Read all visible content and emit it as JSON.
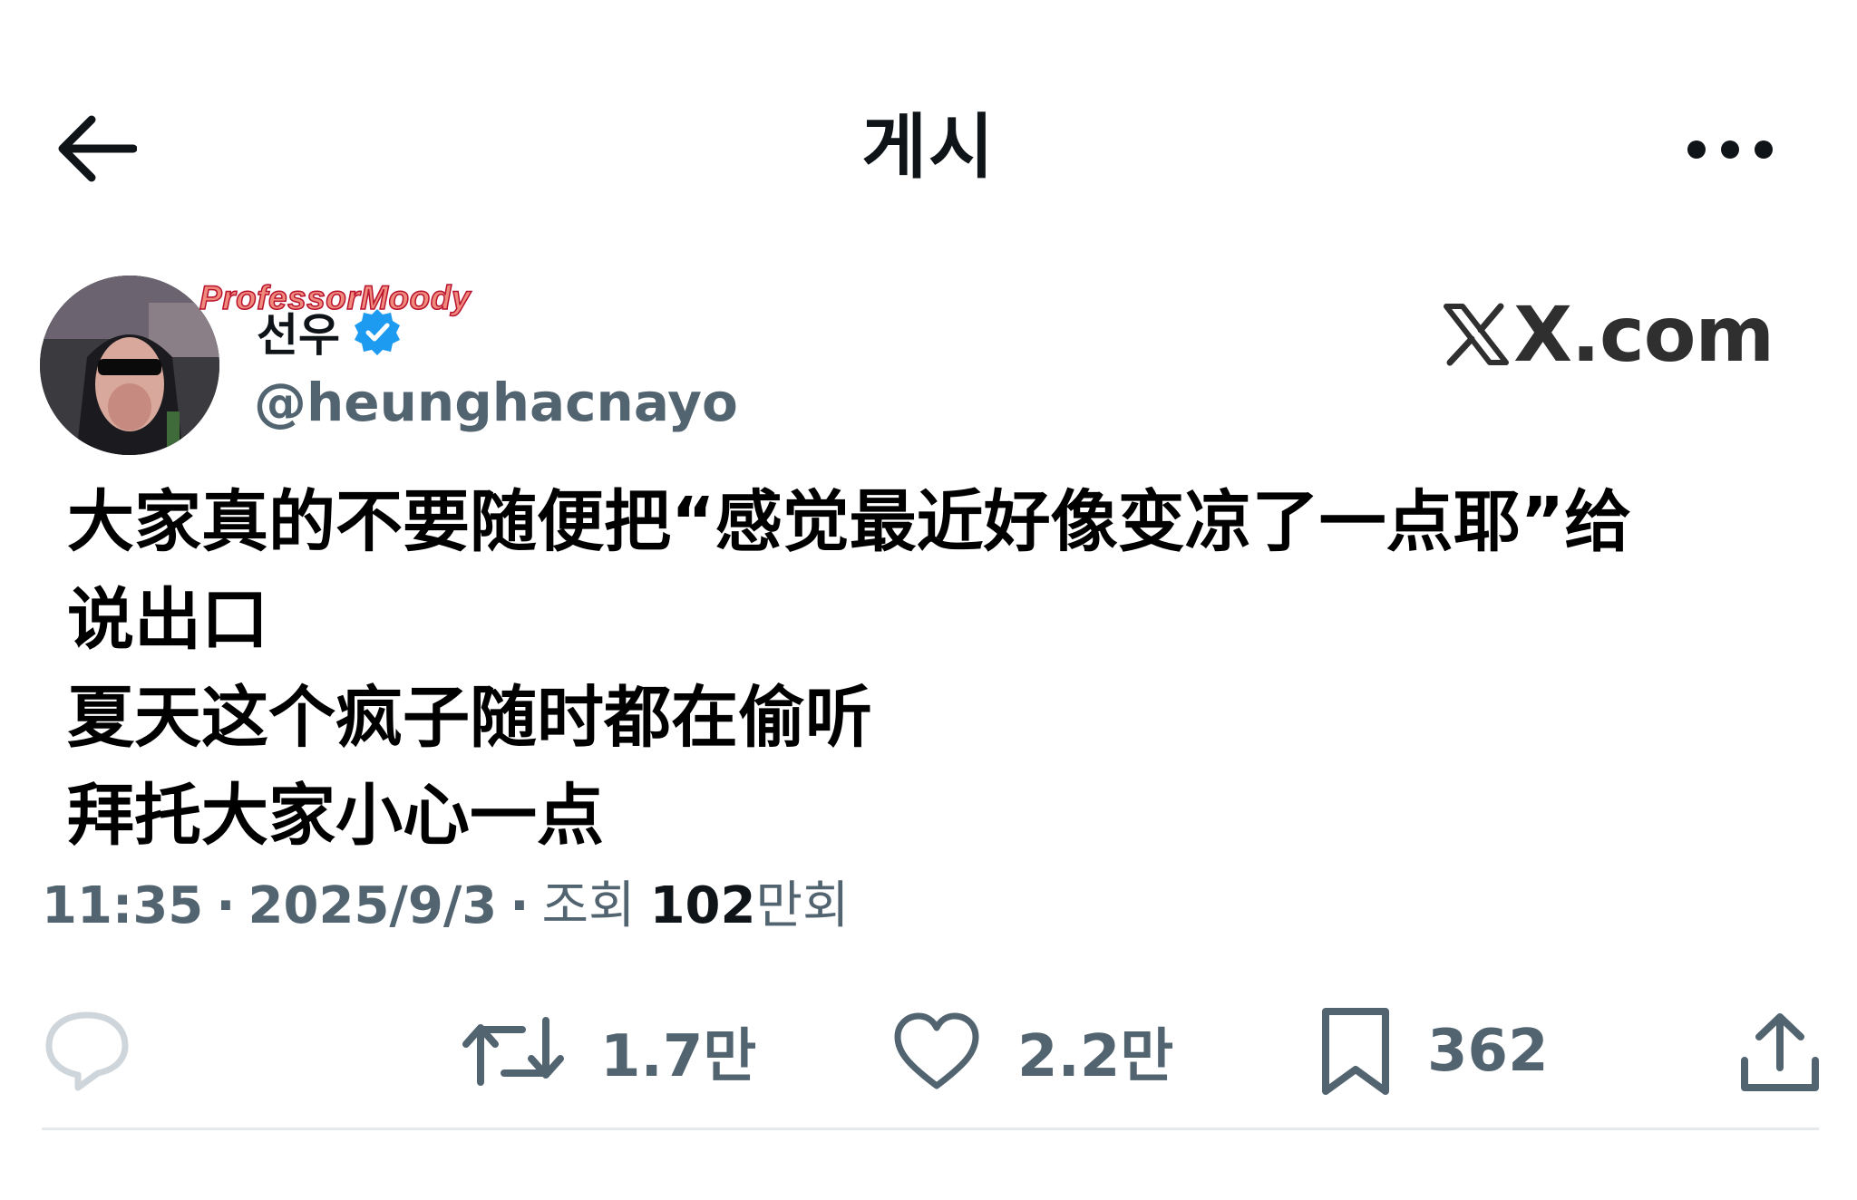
{
  "header": {
    "title": "게시"
  },
  "author": {
    "display_name": "선우",
    "handle": "@heunghacnayo",
    "verified": true,
    "watermark": "ProfessorMoody"
  },
  "brand": {
    "site": "X.com"
  },
  "post": {
    "lines": [
      "大家真的不要随便把“感觉最近好像变凉了一点耶”给",
      "说出口",
      "夏天这个疯子随时都在偷听",
      "拜托大家小心一点"
    ]
  },
  "meta": {
    "time": "11:35",
    "date": "2025/9/3",
    "views_label": "조회",
    "views_count": "102",
    "views_unit": "만회"
  },
  "actions": {
    "retweets": "1.7만",
    "likes": "2.2만",
    "bookmarks": "362"
  },
  "colors": {
    "text": "#0f1419",
    "secondary": "#536471",
    "verified": "#1d9bf0",
    "watermark": "#f08a7c",
    "divider": "#e6e9ec"
  },
  "icons": [
    "back-arrow-icon",
    "more-icon",
    "verified-badge-icon",
    "x-logo-icon",
    "reply-icon",
    "retweet-icon",
    "heart-icon",
    "bookmark-icon",
    "share-icon"
  ]
}
